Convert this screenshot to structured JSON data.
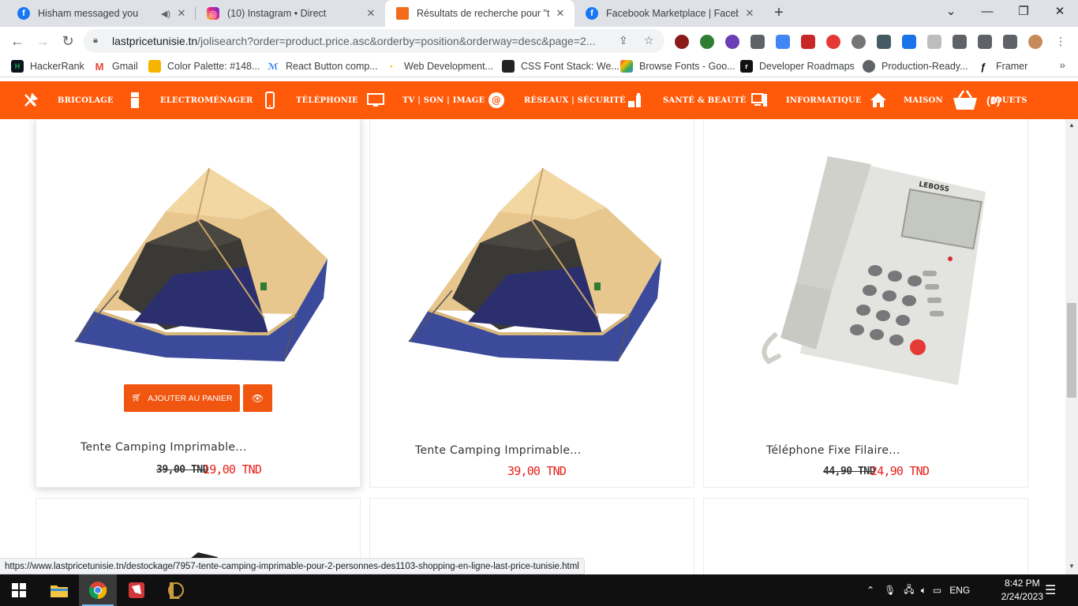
{
  "browser": {
    "tabs": [
      {
        "title": "Hisham messaged you",
        "favicon": "facebook-icon",
        "audio": true
      },
      {
        "title": "(10) Instagram • Direct",
        "favicon": "instagram-icon"
      },
      {
        "title": "Résultats de recherche pour \"tente",
        "favicon": "lastprice-icon",
        "active": true
      },
      {
        "title": "Facebook Marketplace | Facebook",
        "favicon": "facebook-icon"
      }
    ],
    "url_host": "lastpricetunisie.tn",
    "url_path": "/jolisearch?order=product.price.asc&orderby=position&orderway=desc&page=2...",
    "bookmarks": [
      {
        "label": "HackerRank",
        "icon": "hackerrank-icon",
        "color": "#1ba94c"
      },
      {
        "label": "Gmail",
        "icon": "gmail-icon",
        "color": "#ea4335"
      },
      {
        "label": "Color Palette: #148...",
        "icon": "palette-icon",
        "color": "#f4b400"
      },
      {
        "label": "React Button comp...",
        "icon": "react-icon",
        "color": "#61dafb"
      },
      {
        "label": "Web Development...",
        "icon": "pin-icon",
        "color": "#f4c20d"
      },
      {
        "label": "CSS Font Stack: We...",
        "icon": "cssfont-icon",
        "color": "#222222"
      },
      {
        "label": "Browse Fonts - Goo...",
        "icon": "googlefonts-icon",
        "color": "#4285f4"
      },
      {
        "label": "Developer Roadmaps",
        "icon": "roadmap-icon",
        "color": "#111111"
      },
      {
        "label": "Production-Ready...",
        "icon": "globe-icon",
        "color": "#5f6368"
      },
      {
        "label": "Framer",
        "icon": "framer-icon",
        "color": "#111111"
      }
    ]
  },
  "site_nav": [
    {
      "label": "BRICOLAGE",
      "icon": "tools-icon"
    },
    {
      "label": "ELECTROMÉNAGER",
      "icon": "fridge-icon"
    },
    {
      "label": "TÉLÉPHONIE",
      "icon": "phone-icon"
    },
    {
      "label": "TV | SON | IMAGE",
      "icon": "tv-icon"
    },
    {
      "label": "RÉSEAUX | SÉCURITÉ",
      "icon": "network-icon"
    },
    {
      "label": "SANTÉ & BEAUTÉ",
      "icon": "beauty-icon"
    },
    {
      "label": "INFORMATIQUE",
      "icon": "computer-icon"
    },
    {
      "label": "MAISON",
      "icon": "home-icon"
    },
    {
      "label": "JOUETS",
      "icon": "basket-icon"
    }
  ],
  "cart": {
    "count": "(0)"
  },
  "products": [
    {
      "name": "Tente Camping Imprimable...",
      "old_price": "39,00 TND",
      "price": "19,00 TND",
      "add_to_cart": "AJOUTER AU PANIER"
    },
    {
      "name": "Tente Camping Imprimable...",
      "old_price": "",
      "price": "39,00 TND"
    },
    {
      "name": "Téléphone Fixe Filaire...",
      "old_price": "44,90 TND",
      "price": "24,90 TND",
      "phone_brand": "LEBOSS"
    }
  ],
  "status_url": "https://www.lastpricetunisie.tn/destockage/7957-tente-camping-imprimable-pour-2-personnes-des1103-shopping-en-ligne-last-price-tunisie.html",
  "taskbar": {
    "language": "ENG",
    "time": "8:42 PM",
    "date": "2/24/2023"
  }
}
